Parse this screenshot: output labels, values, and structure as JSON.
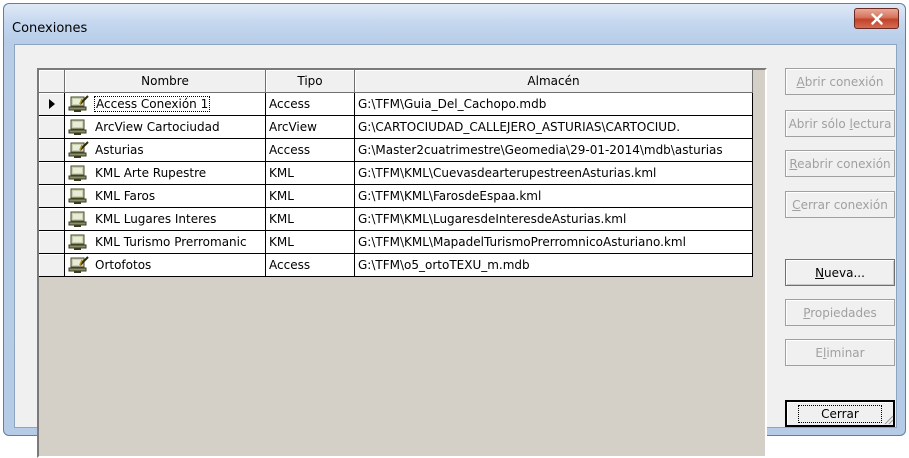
{
  "window": {
    "title": "Conexiones"
  },
  "grid": {
    "columns": [
      "Nombre",
      "Tipo",
      "Almacén"
    ],
    "rows": [
      {
        "name": "Access Conexión 1",
        "type": "Access",
        "store": "G:\\TFM\\Guia_Del_Cachopo.mdb",
        "icon": "access-connection-icon"
      },
      {
        "name": "ArcView Cartociudad",
        "type": "ArcView",
        "store": "G:\\CARTOCIUDAD_CALLEJERO_ASTURIAS\\CARTOCIUD.",
        "icon": "network-connection-icon"
      },
      {
        "name": "Asturias",
        "type": "Access",
        "store": "G:\\Master2cuatrimestre\\Geomedia\\29-01-2014\\mdb\\asturias",
        "icon": "access-connection-icon"
      },
      {
        "name": "KML Arte Rupestre",
        "type": "KML",
        "store": "G:\\TFM\\KML\\CuevasdearterupestreenAsturias.kml",
        "icon": "network-connection-icon"
      },
      {
        "name": "KML Faros",
        "type": "KML",
        "store": "G:\\TFM\\KML\\FarosdeEspaa.kml",
        "icon": "network-connection-icon"
      },
      {
        "name": "KML Lugares Interes",
        "type": "KML",
        "store": "G:\\TFM\\KML\\LugaresdeInteresdeAsturias.kml",
        "icon": "network-connection-icon"
      },
      {
        "name": "KML Turismo Prerromanic",
        "type": "KML",
        "store": "G:\\TFM\\KML\\MapadelTurismoPrerromnicoAsturiano.kml",
        "icon": "network-connection-icon"
      },
      {
        "name": "Ortofotos",
        "type": "Access",
        "store": "G:\\TFM\\o5_ortoTEXU_m.mdb",
        "icon": "access-connection-icon"
      }
    ],
    "selected_row": 0
  },
  "buttons": {
    "open": {
      "pre": "",
      "key": "A",
      "post": "brir conexión"
    },
    "open_readonly": {
      "pre": "Abrir sólo ",
      "key": "l",
      "post": "ectura"
    },
    "reopen": {
      "pre": "",
      "key": "R",
      "post": "eabrir conexión"
    },
    "close_conn": {
      "pre": "",
      "key": "C",
      "post": "errar conexión"
    },
    "new": {
      "pre": "",
      "key": "N",
      "post": "ueva..."
    },
    "properties": {
      "pre": "",
      "key": "P",
      "post": "ropiedades"
    },
    "delete": {
      "pre": "E",
      "key": "l",
      "post": "iminar"
    },
    "close": {
      "label": "Cerrar"
    }
  },
  "colors": {
    "close_button": "#c1432a",
    "disabled_text": "#a0a0a0",
    "grid_background": "#d4d0c8"
  }
}
